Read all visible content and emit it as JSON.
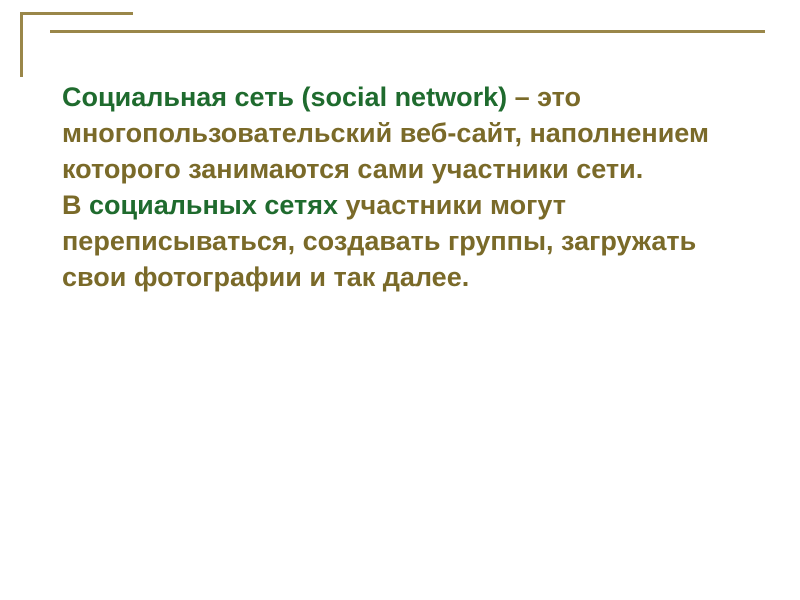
{
  "colors": {
    "green": "#1f6b2e",
    "olive": "#7a6a29",
    "border": "#9a8749"
  },
  "slide": {
    "p1": {
      "s1": "Социальная сеть (social network)",
      "s2": " – это многопользовательский веб-сайт, наполнением которого занимаются сами участники сети."
    },
    "p2": {
      "s1": "В ",
      "s2": "социальных сетях",
      "s3": " участники могут переписываться, создавать группы, загружать свои фотографии и так далее."
    }
  }
}
